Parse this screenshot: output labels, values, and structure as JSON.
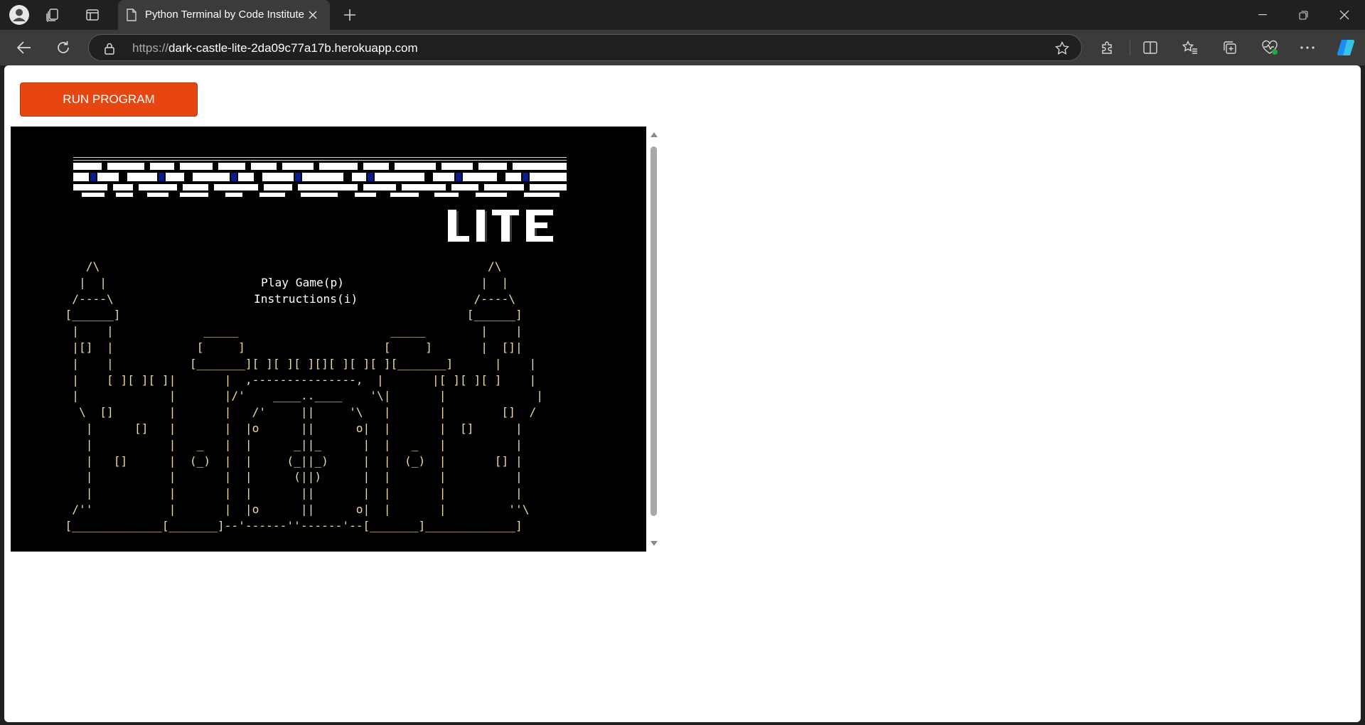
{
  "browser": {
    "tab": {
      "title": "Python Terminal by Code Institute"
    },
    "address": {
      "scheme": "https://",
      "host": "dark-castle-lite-2da09c77a17b.herokuapp.com"
    },
    "icons": {
      "profile": "profile-icon",
      "workspaces": "workspaces-icon",
      "tab_actions": "tab-actions-icon",
      "page": "page-icon",
      "close_tab": "close-icon",
      "new_tab": "plus-icon",
      "back": "back-arrow-icon",
      "refresh": "refresh-icon",
      "lock": "lock-icon",
      "favorite": "star-icon",
      "extensions": "puzzle-icon",
      "split_screen": "split-screen-icon",
      "favorites": "favorites-icon",
      "collections": "collections-icon",
      "browser_essentials": "heart-pulse-icon",
      "more": "more-icon",
      "copilot": "copilot-icon",
      "minimize": "minimize-icon",
      "restore": "restore-icon",
      "close_window": "close-window-icon"
    }
  },
  "page": {
    "run_button": "RUN PROGRAM",
    "banner_word": "LITE",
    "menu": {
      "play": "Play Game(p)",
      "instructions": "Instructions(i)"
    },
    "ascii_castle": " /\\ | | /----\\ [______] Play Game(p) Instructions(i) [____] [ ] [______][ ][ ][ ][][ ][ ][ ][______] ,---------------, ____..____ (_||_) (||)"
  },
  "colors": {
    "run_button": "#e84610",
    "terminal_bg": "#000000",
    "ascii_text": "#ecd9a6",
    "menu_text": "#ffffff"
  }
}
